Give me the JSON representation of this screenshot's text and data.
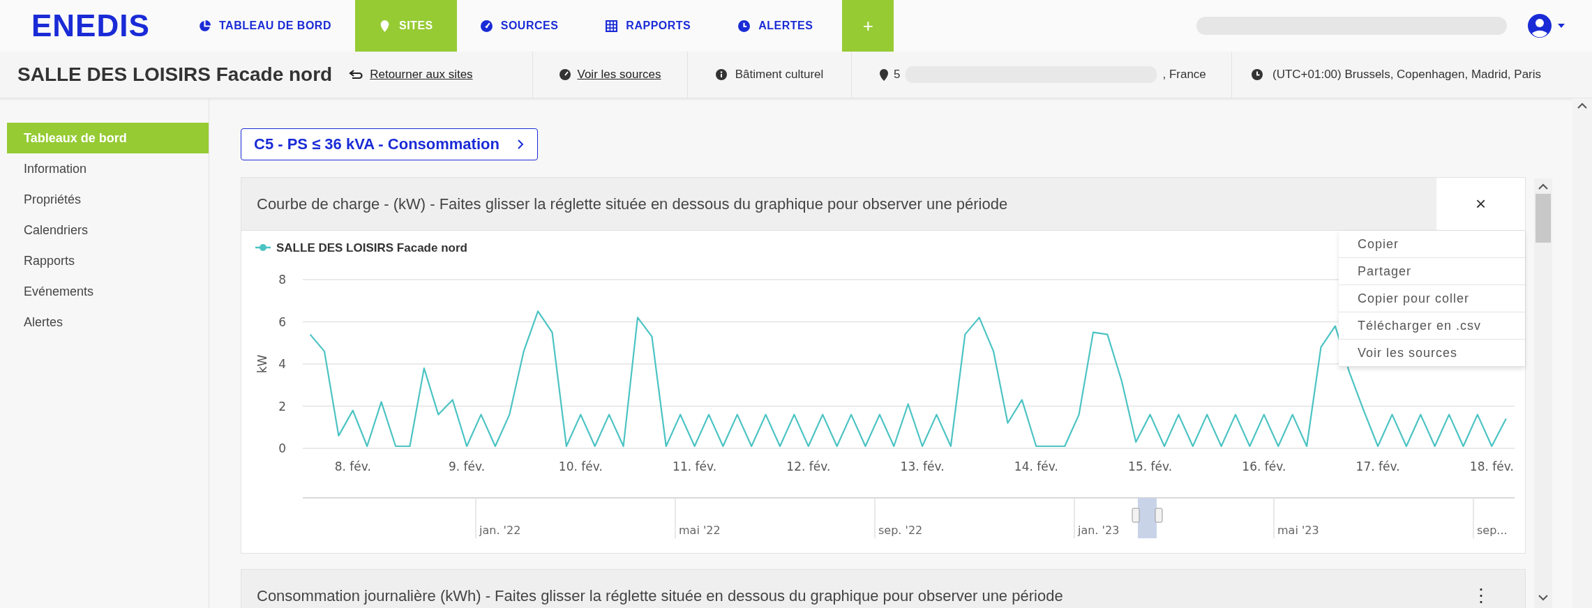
{
  "logo": "ENEDIS",
  "nav": [
    {
      "label": "TABLEAU DE BORD",
      "selected": false
    },
    {
      "label": "SITES",
      "selected": true
    },
    {
      "label": "SOURCES",
      "selected": false
    },
    {
      "label": "RAPPORTS",
      "selected": false
    },
    {
      "label": "ALERTES",
      "selected": false
    }
  ],
  "add_button": "+",
  "site": {
    "title": "SALLE DES LOISIRS Facade nord",
    "back_link": "Retourner aux sites",
    "sources_link": "Voir les sources",
    "category": "Bâtiment culturel",
    "address_start": "5",
    "address_end": ", France",
    "timezone": "(UTC+01:00) Brussels, Copenhagen, Madrid, Paris"
  },
  "sidebar": {
    "items": [
      {
        "label": "Tableaux de bord",
        "selected": true
      },
      {
        "label": "Information",
        "selected": false
      },
      {
        "label": "Propriétés",
        "selected": false
      },
      {
        "label": "Calendriers",
        "selected": false
      },
      {
        "label": "Rapports",
        "selected": false
      },
      {
        "label": "Evénements",
        "selected": false
      },
      {
        "label": "Alertes",
        "selected": false
      }
    ]
  },
  "dashboard_button": "C5 - PS ≤ 36 kVA - Consommation",
  "cards": [
    {
      "title": "Courbe de charge - (kW) - Faites glisser la réglette située en dessous du graphique pour observer une période",
      "action": "×",
      "chart_data": {
        "type": "line",
        "grid": true,
        "ylabel": "kW",
        "xlim": [
          7.56,
          18.2
        ],
        "ylim": [
          0,
          8
        ],
        "yticks": [
          0,
          2,
          4,
          6,
          8
        ],
        "xticks": [
          {
            "value": 8,
            "label": "8. fév."
          },
          {
            "value": 9,
            "label": "9. fév."
          },
          {
            "value": 10,
            "label": "10. fév."
          },
          {
            "value": 11,
            "label": "11. fév."
          },
          {
            "value": 12,
            "label": "12. fév."
          },
          {
            "value": 13,
            "label": "13. fév."
          },
          {
            "value": 14,
            "label": "14. fév."
          },
          {
            "value": 15,
            "label": "15. fév."
          },
          {
            "value": 16,
            "label": "16. fév."
          },
          {
            "value": 17,
            "label": "17. fév."
          },
          {
            "value": 18,
            "label": "18. fév."
          }
        ],
        "x": [
          7.625,
          7.75,
          7.875,
          8,
          8.125,
          8.25,
          8.375,
          8.5,
          8.625,
          8.75,
          8.875,
          9,
          9.125,
          9.25,
          9.375,
          9.5,
          9.625,
          9.75,
          9.875,
          10,
          10.125,
          10.25,
          10.375,
          10.5,
          10.625,
          10.75,
          10.875,
          11,
          11.125,
          11.25,
          11.375,
          11.5,
          11.625,
          11.75,
          11.875,
          12,
          12.125,
          12.25,
          12.375,
          12.5,
          12.625,
          12.75,
          12.875,
          13,
          13.125,
          13.25,
          13.375,
          13.5,
          13.625,
          13.75,
          13.875,
          14,
          14.125,
          14.25,
          14.375,
          14.5,
          14.625,
          14.75,
          14.875,
          15,
          15.125,
          15.25,
          15.375,
          15.5,
          15.625,
          15.75,
          15.875,
          16,
          16.125,
          16.25,
          16.375,
          16.5,
          16.625,
          16.75,
          16.875,
          17,
          17.125,
          17.25,
          17.375,
          17.5,
          17.625,
          17.75,
          17.875,
          18,
          18.125
        ],
        "series": [
          {
            "name": "SALLE DES LOISIRS Facade nord",
            "color": "#4cc3c3",
            "values": [
              5.4,
              4.6,
              0.6,
              1.8,
              0.1,
              2.2,
              0.1,
              0.1,
              3.8,
              1.6,
              2.3,
              0.1,
              1.6,
              0.1,
              1.6,
              4.6,
              6.5,
              5.5,
              0.1,
              1.6,
              0.1,
              1.6,
              0.1,
              6.2,
              5.3,
              0.1,
              1.6,
              0.1,
              1.6,
              0.1,
              1.6,
              0.1,
              1.6,
              0.1,
              1.6,
              0.1,
              1.6,
              0.1,
              1.6,
              0.1,
              1.6,
              0.1,
              2.1,
              0.1,
              1.6,
              0.1,
              5.4,
              6.2,
              4.6,
              1.2,
              2.3,
              0.1,
              0.1,
              0.1,
              1.6,
              5.5,
              5.4,
              3.2,
              0.3,
              1.6,
              0.1,
              1.6,
              0.1,
              1.6,
              0.1,
              1.6,
              0.1,
              1.6,
              0.1,
              1.6,
              0.1,
              4.8,
              5.8,
              3.6,
              1.8,
              0.1,
              1.6,
              0.1,
              1.6,
              0.1,
              1.6,
              0.1,
              1.6,
              0.1,
              1.4
            ]
          }
        ]
      },
      "navigator": {
        "labels": [
          "jan. '22",
          "mai '22",
          "sep. '22",
          "jan. '23",
          "mai '23",
          "sep..."
        ]
      },
      "menu": [
        "Copier",
        "Partager",
        "Copier pour coller",
        "Télécharger en .csv",
        "Voir les sources"
      ]
    },
    {
      "title": "Consommation journalière (kWh) - Faites glisser la réglette située en dessous du graphique pour observer une période",
      "action": "⋮"
    }
  ]
}
